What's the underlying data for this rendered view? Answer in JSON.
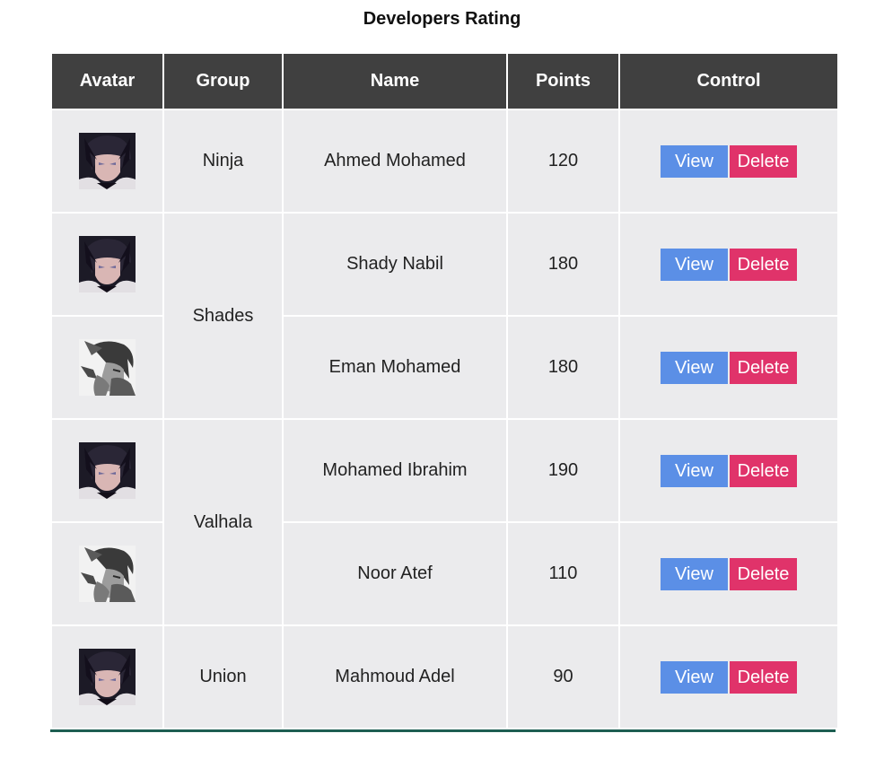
{
  "title": "Developers Rating",
  "colors": {
    "header_bg": "#404040",
    "cell_bg": "#ebebed",
    "view_button": "#5b8fe6",
    "delete_button": "#e0336a",
    "bottom_line": "#1d5e52"
  },
  "table": {
    "headers": {
      "avatar": "Avatar",
      "group": "Group",
      "name": "Name",
      "points": "Points",
      "control": "Control"
    },
    "rows": [
      {
        "avatar": "dark-haired-character-avatar",
        "group": "Ninja",
        "name": "Ahmed Mohamed",
        "points": "120",
        "view": "View",
        "delete": "Delete"
      },
      {
        "avatar": "dark-haired-character-avatar",
        "group": "Shades",
        "name": "Shady Nabil",
        "points": "180",
        "view": "View",
        "delete": "Delete"
      },
      {
        "avatar": "monochrome-character-avatar",
        "group": "Shades",
        "name": "Eman Mohamed",
        "points": "180",
        "view": "View",
        "delete": "Delete"
      },
      {
        "avatar": "dark-haired-character-avatar",
        "group": "Valhala",
        "name": "Mohamed Ibrahim",
        "points": "190",
        "view": "View",
        "delete": "Delete"
      },
      {
        "avatar": "monochrome-character-avatar",
        "group": "Valhala",
        "name": "Noor Atef",
        "points": "110",
        "view": "View",
        "delete": "Delete"
      },
      {
        "avatar": "dark-haired-character-avatar",
        "group": "Union",
        "name": "Mahmoud Adel",
        "points": "90",
        "view": "View",
        "delete": "Delete"
      }
    ]
  }
}
